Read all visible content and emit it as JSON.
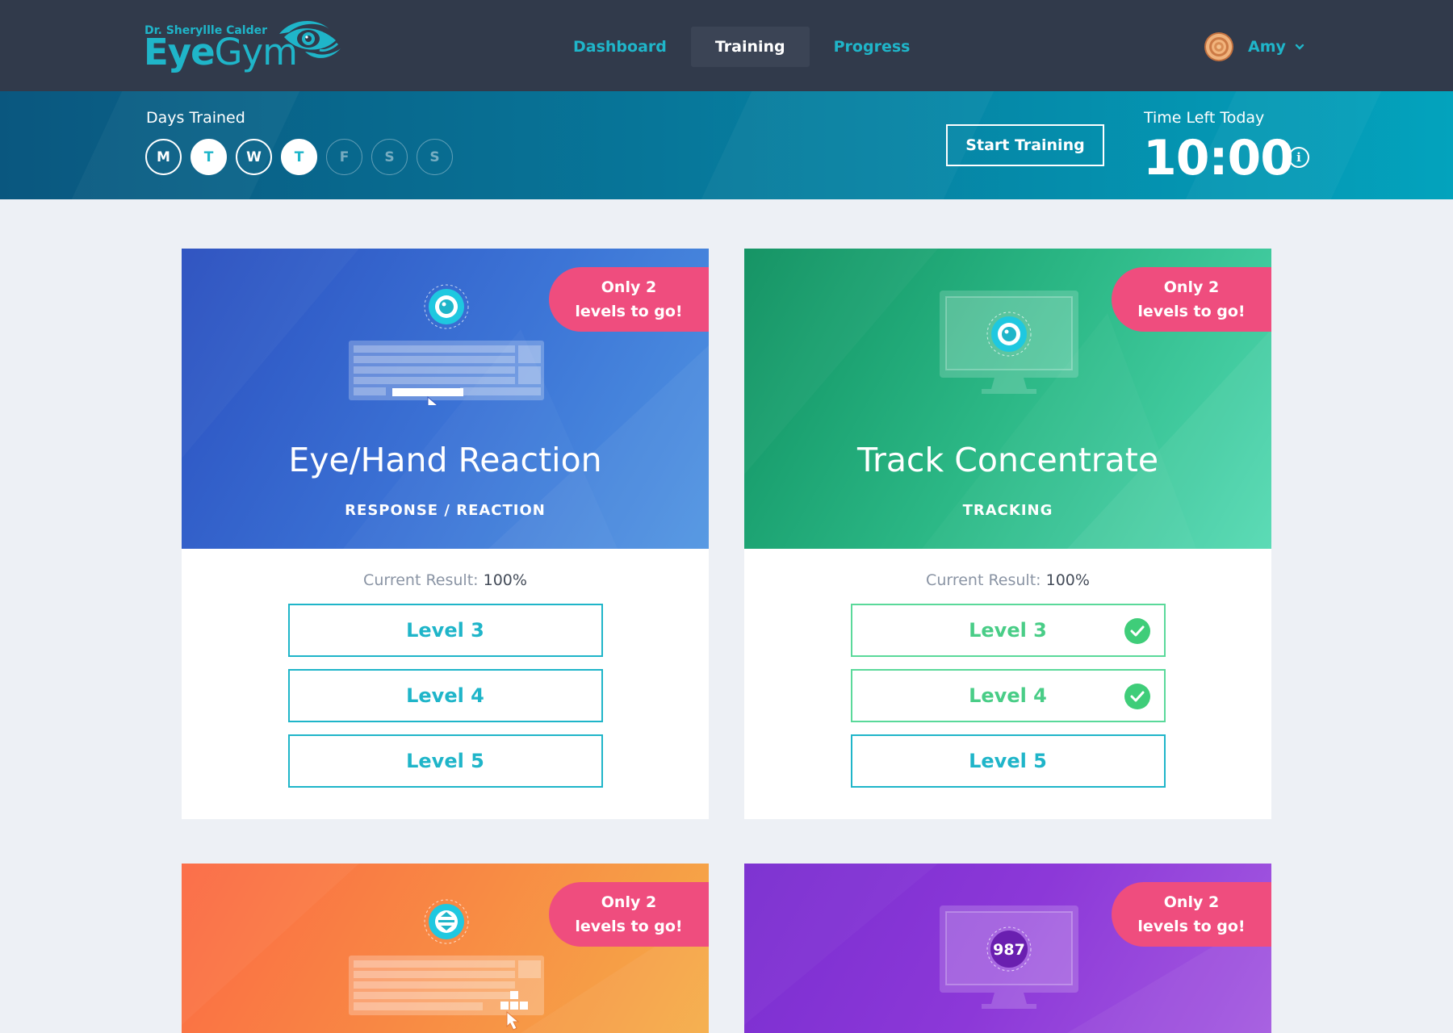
{
  "brand": {
    "small": "Dr. Sheryllle Calder",
    "eye": "Eye",
    "gym": "Gym"
  },
  "nav": {
    "items": [
      {
        "label": "Dashboard",
        "active": false
      },
      {
        "label": "Training",
        "active": true
      },
      {
        "label": "Progress",
        "active": false
      }
    ]
  },
  "user": {
    "name": "Amy",
    "avatar_icon": "avatar-image",
    "menu_icon": "chevron-down-icon"
  },
  "banner": {
    "days_label": "Days Trained",
    "days": [
      {
        "letter": "M",
        "state": "done"
      },
      {
        "letter": "T",
        "state": "today"
      },
      {
        "letter": "W",
        "state": "done"
      },
      {
        "letter": "T",
        "state": "today"
      },
      {
        "letter": "F",
        "state": "future"
      },
      {
        "letter": "S",
        "state": "future"
      },
      {
        "letter": "S",
        "state": "future"
      }
    ],
    "start_button": "Start Training",
    "time_label": "Time Left Today",
    "time_value": "10:00",
    "info_icon": "info-icon"
  },
  "colors": {
    "accent": "#1fb5c9",
    "topbar": "#313a4b",
    "badge": "#ef4d7e",
    "complete": "#3fcd79"
  },
  "cards": [
    {
      "title": "Eye/Hand Reaction",
      "subtitle": "RESPONSE / REACTION",
      "badge_line1": "Only 2",
      "badge_line2": "levels to go!",
      "result_label": "Current Result:",
      "result_value": "100%",
      "illustration": "keyboard-icon",
      "levels": [
        {
          "label": "Level 3",
          "complete": false
        },
        {
          "label": "Level 4",
          "complete": false
        },
        {
          "label": "Level 5",
          "complete": false
        }
      ]
    },
    {
      "title": "Track Concentrate",
      "subtitle": "TRACKING",
      "badge_line1": "Only 2",
      "badge_line2": "levels to go!",
      "result_label": "Current Result:",
      "result_value": "100%",
      "illustration": "monitor-icon",
      "levels": [
        {
          "label": "Level 3",
          "complete": true
        },
        {
          "label": "Level 4",
          "complete": true
        },
        {
          "label": "Level 5",
          "complete": false
        }
      ]
    },
    {
      "badge_line1": "Only 2",
      "badge_line2": "levels to go!",
      "illustration": "keyboard-icon"
    },
    {
      "badge_line1": "Only 2",
      "badge_line2": "levels to go!",
      "illustration": "monitor-icon",
      "screen_number": "987"
    }
  ]
}
